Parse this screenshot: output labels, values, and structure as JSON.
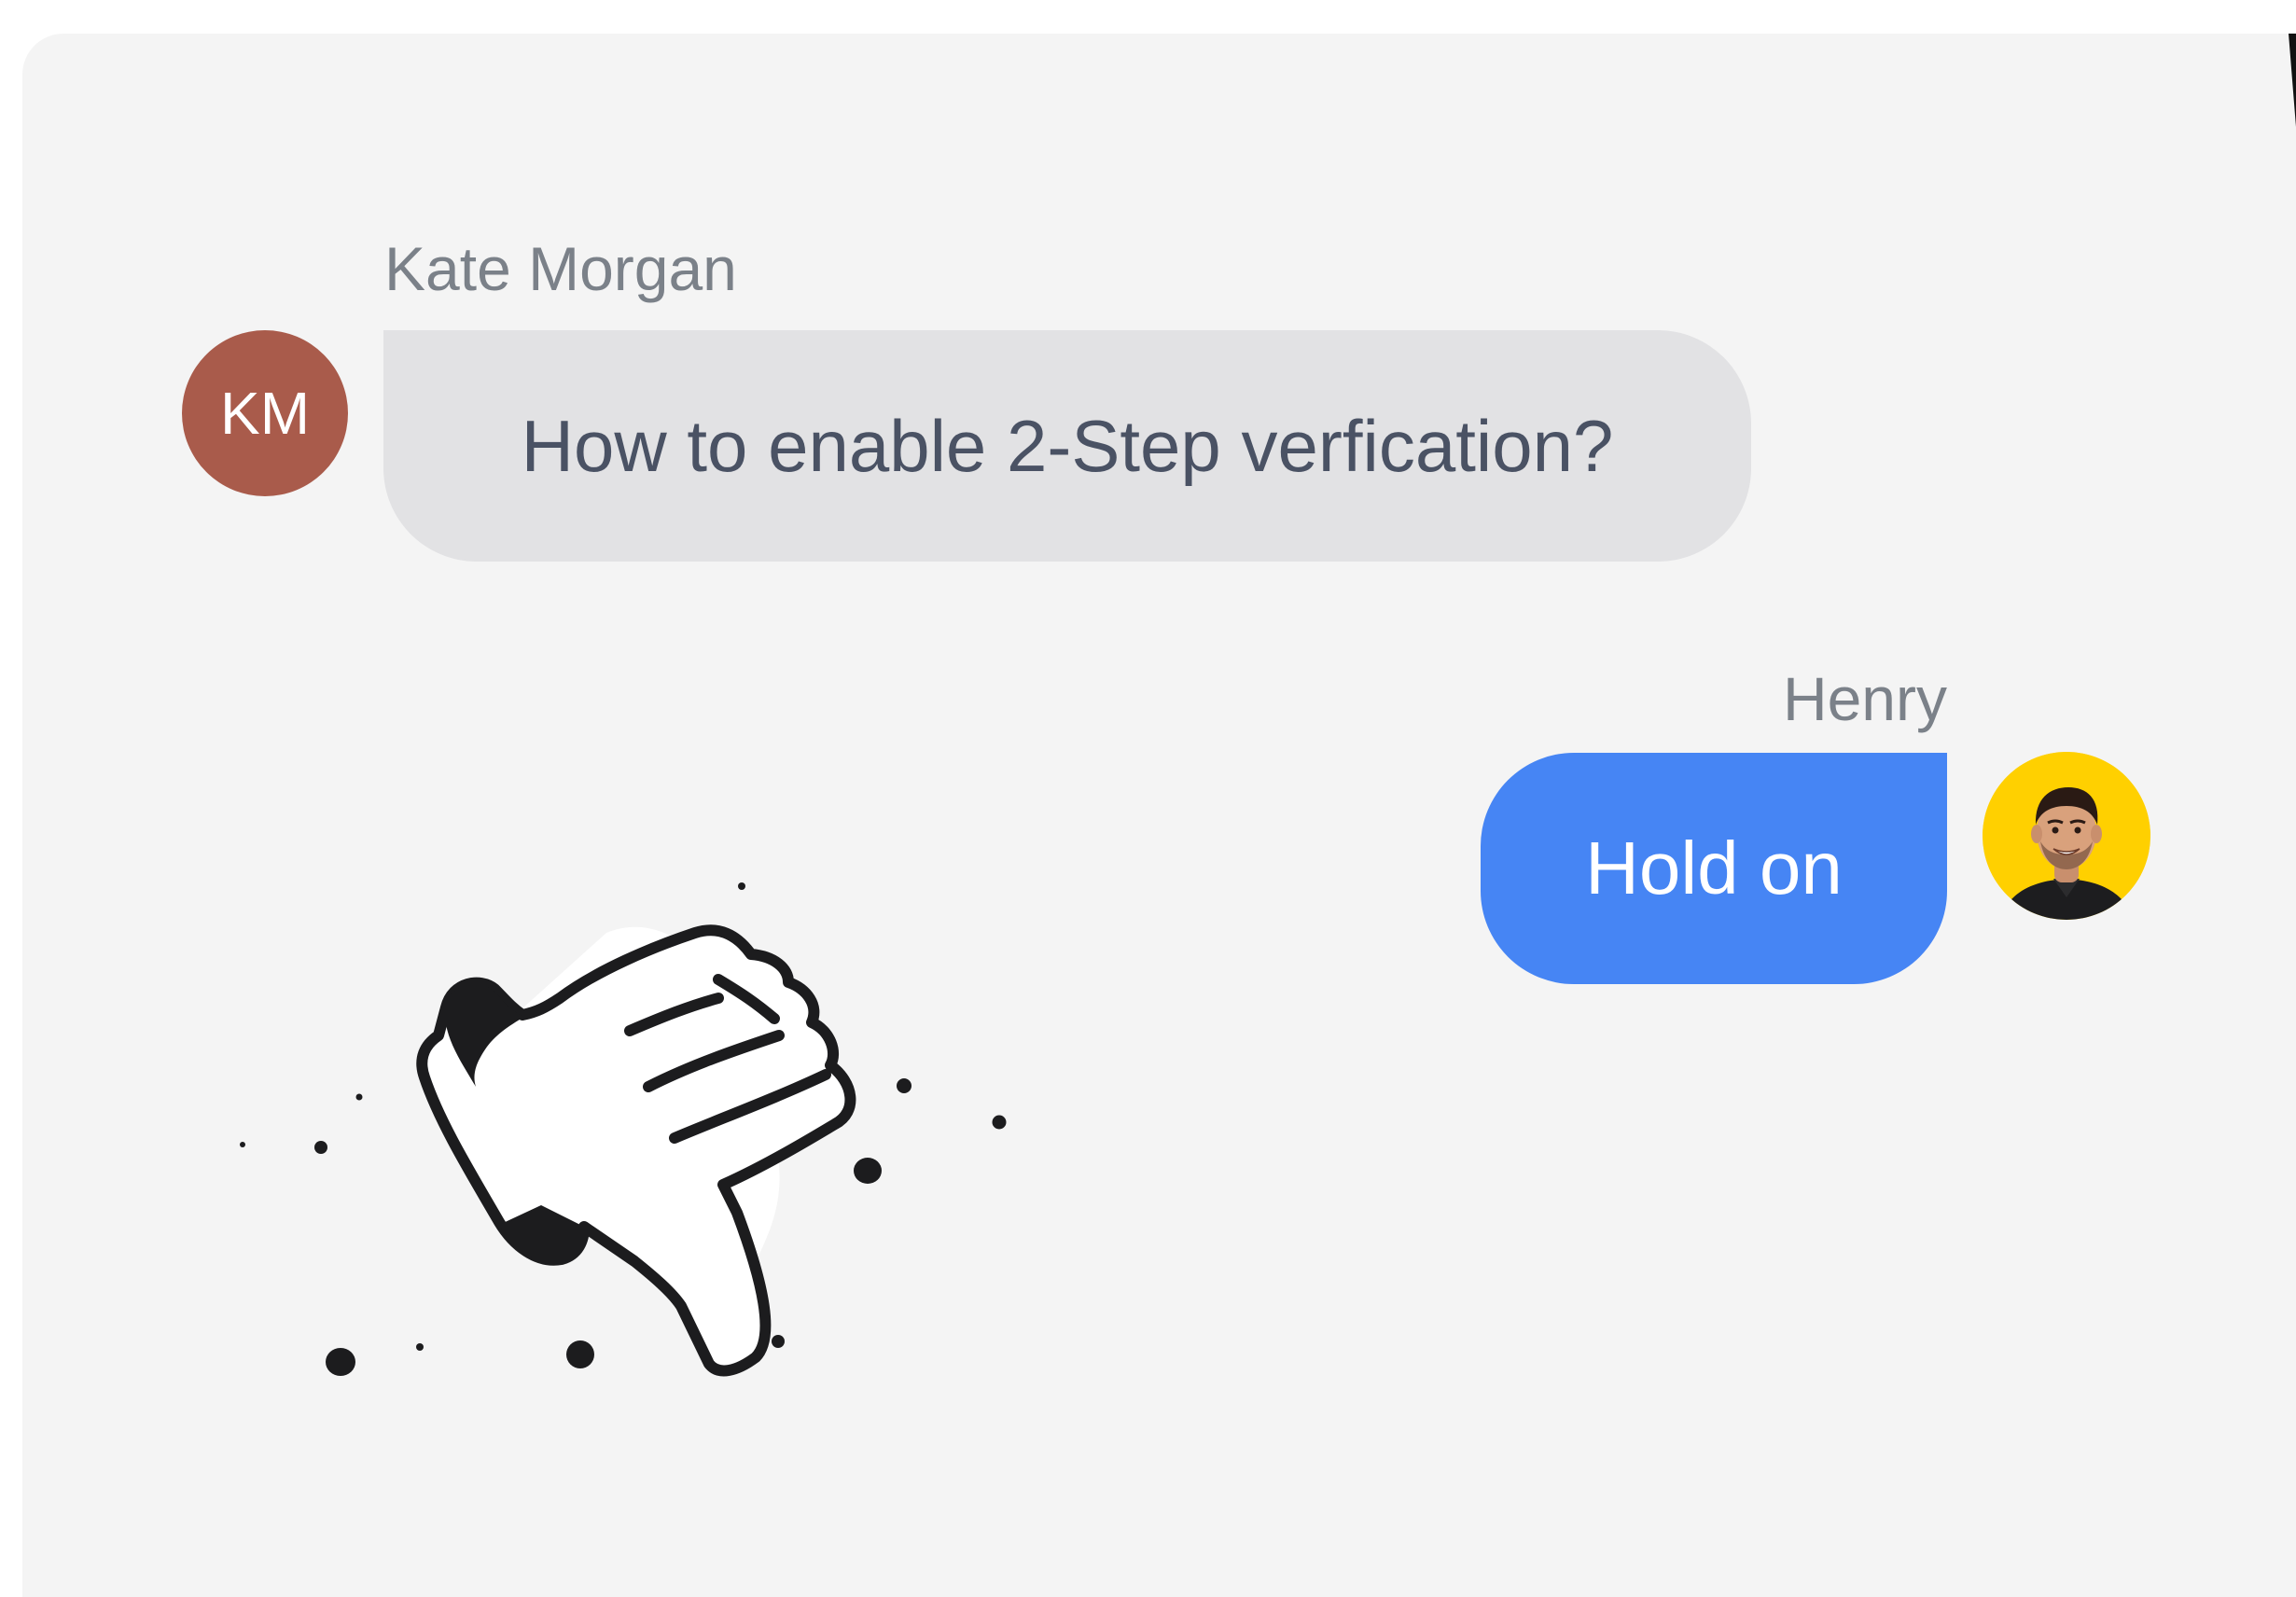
{
  "conversation": {
    "incoming": {
      "sender": "Kate Morgan",
      "initials": "KM",
      "message": "How to enable 2-Step verfication?"
    },
    "outgoing": {
      "sender": "Henry",
      "message": "Hold on"
    }
  },
  "icons": {
    "illustration": "thumbs-down-icon",
    "avatar": "person-photo-avatar"
  },
  "colors": {
    "panel_bg": "#f4f4f4",
    "incoming_bubble": "#e2e2e4",
    "outgoing_bubble": "#4685f4",
    "initials_avatar": "#a95b4b",
    "photo_avatar_bg": "#ffd000"
  }
}
